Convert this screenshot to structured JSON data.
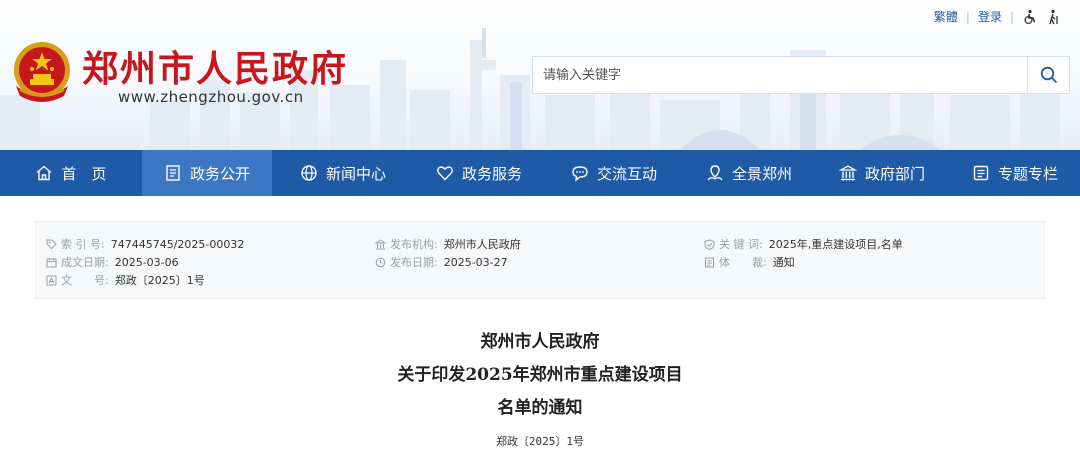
{
  "topbar": {
    "traditional": "繁體",
    "login": "登录"
  },
  "site": {
    "title": "郑州市人民政府",
    "url": "www.zhengzhou.gov.cn"
  },
  "search": {
    "placeholder": "请输入关键字"
  },
  "nav": [
    {
      "label": "首　页",
      "icon": "home-icon"
    },
    {
      "label": "政务公开",
      "icon": "document-icon",
      "active": true
    },
    {
      "label": "新闻中心",
      "icon": "globe-icon"
    },
    {
      "label": "政务服务",
      "icon": "heart-icon"
    },
    {
      "label": "交流互动",
      "icon": "chat-icon"
    },
    {
      "label": "全景郑州",
      "icon": "landscape-icon"
    },
    {
      "label": "政府部门",
      "icon": "building-icon"
    },
    {
      "label": "专题专栏",
      "icon": "list-icon"
    }
  ],
  "meta": {
    "index": {
      "label": "索 引 号:",
      "value": "747445745/2025-00032"
    },
    "created": {
      "label": "成文日期:",
      "value": "2025-03-06"
    },
    "docnum": {
      "label": "文　　号:",
      "value": "郑政〔2025〕1号"
    },
    "publisher": {
      "label": "发布机构:",
      "value": "郑州市人民政府"
    },
    "published": {
      "label": "发布日期:",
      "value": "2025-03-27"
    },
    "keywords": {
      "label": "关 键 词:",
      "value": "2025年,重点建设项目,名单"
    },
    "genre": {
      "label": "体　　裁:",
      "value": "通知"
    }
  },
  "article": {
    "title_line1": "郑州市人民政府",
    "title_line2": "关于印发2025年郑州市重点建设项目",
    "title_line3": "名单的通知",
    "docno": "郑政〔2025〕1号"
  },
  "colors": {
    "brand_red": "#c8161d",
    "nav_blue": "#1f5aa6",
    "nav_active": "#3d76c2"
  }
}
